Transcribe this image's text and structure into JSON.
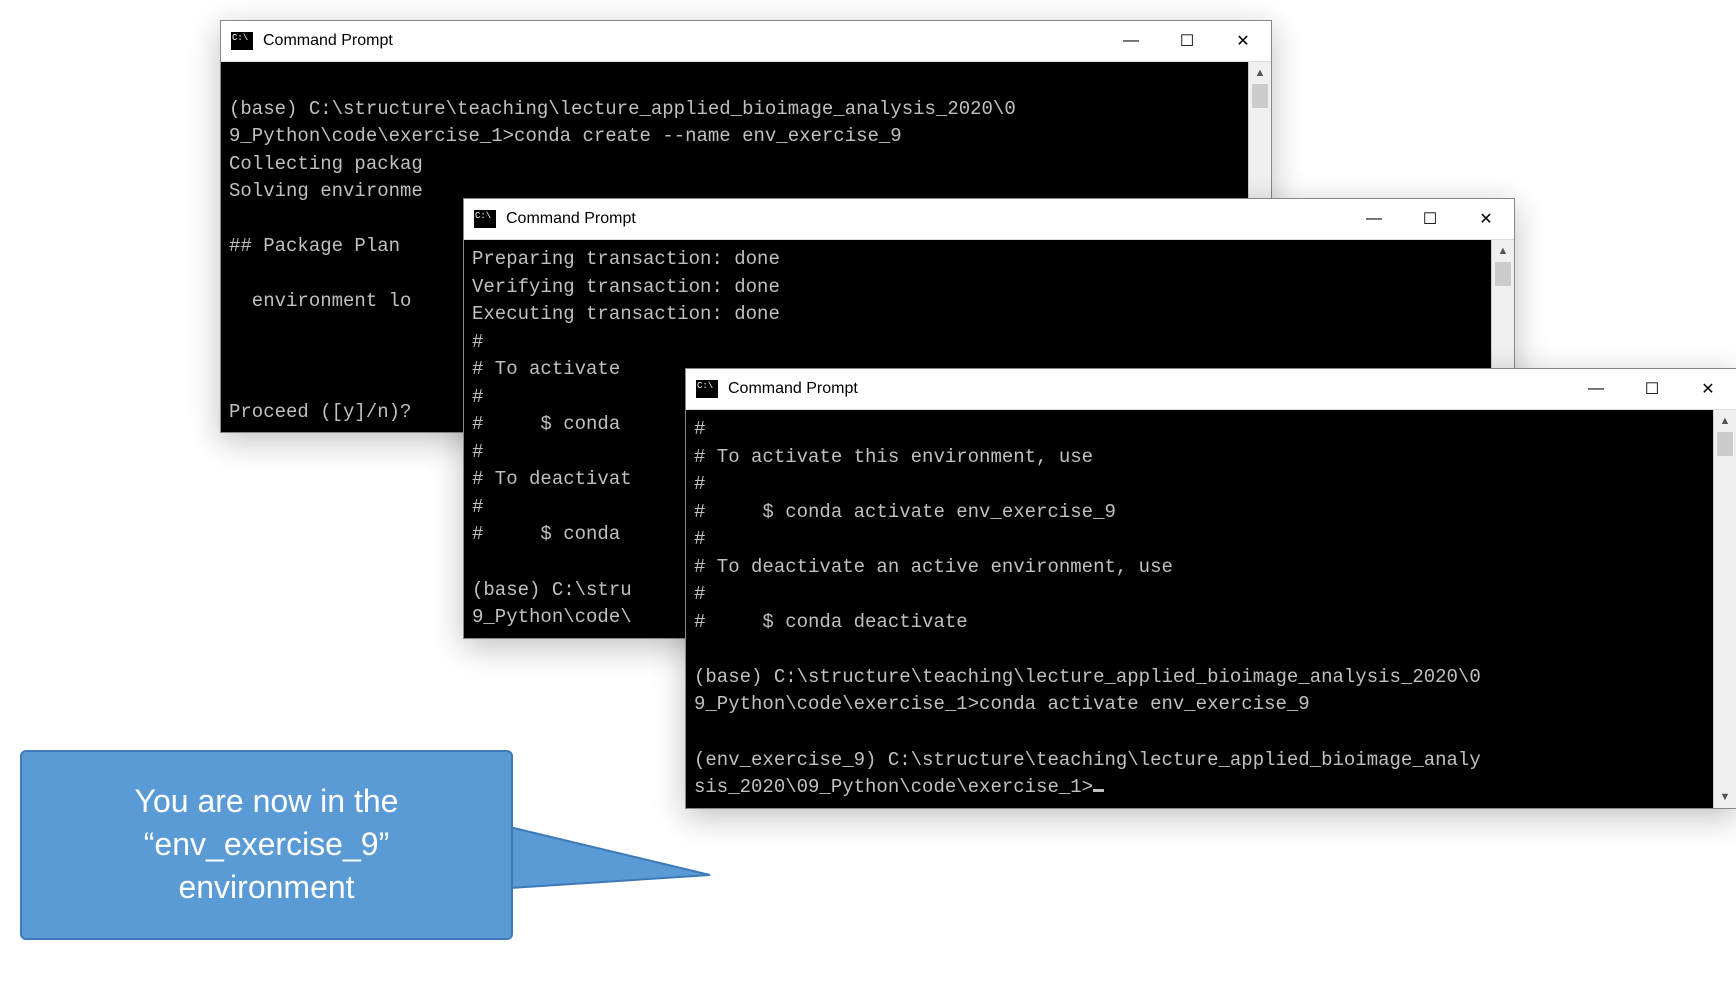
{
  "window1": {
    "title": "Command Prompt",
    "lines": [
      "",
      "(base) C:\\structure\\teaching\\lecture_applied_bioimage_analysis_2020\\0",
      "9_Python\\code\\exercise_1>conda create --name env_exercise_9",
      "Collecting packag",
      "Solving environme",
      "",
      "## Package Plan ",
      "",
      "  environment lo",
      "",
      "",
      "",
      "Proceed ([y]/n)?",
      ""
    ]
  },
  "window2": {
    "title": "Command Prompt",
    "lines": [
      "Preparing transaction: done",
      "Verifying transaction: done",
      "Executing transaction: done",
      "#",
      "# To activate",
      "#",
      "#     $ conda",
      "#",
      "# To deactivat",
      "#",
      "#     $ conda",
      "",
      "(base) C:\\stru",
      "9_Python\\code\\"
    ]
  },
  "window3": {
    "title": "Command Prompt",
    "lines": [
      "#",
      "# To activate this environment, use",
      "#",
      "#     $ conda activate env_exercise_9",
      "#",
      "# To deactivate an active environment, use",
      "#",
      "#     $ conda deactivate",
      "",
      "(base) C:\\structure\\teaching\\lecture_applied_bioimage_analysis_2020\\0",
      "9_Python\\code\\exercise_1>conda activate env_exercise_9",
      "",
      "(env_exercise_9) C:\\structure\\teaching\\lecture_applied_bioimage_analy",
      "sis_2020\\09_Python\\code\\exercise_1>"
    ]
  },
  "callout": {
    "text_l1": "You are now in the",
    "text_l2": "“env_exercise_9”",
    "text_l3": "environment"
  },
  "scroll": {
    "up": "▲",
    "down": "▼"
  },
  "ctrl": {
    "min": "—",
    "max": "☐",
    "close": "✕"
  }
}
